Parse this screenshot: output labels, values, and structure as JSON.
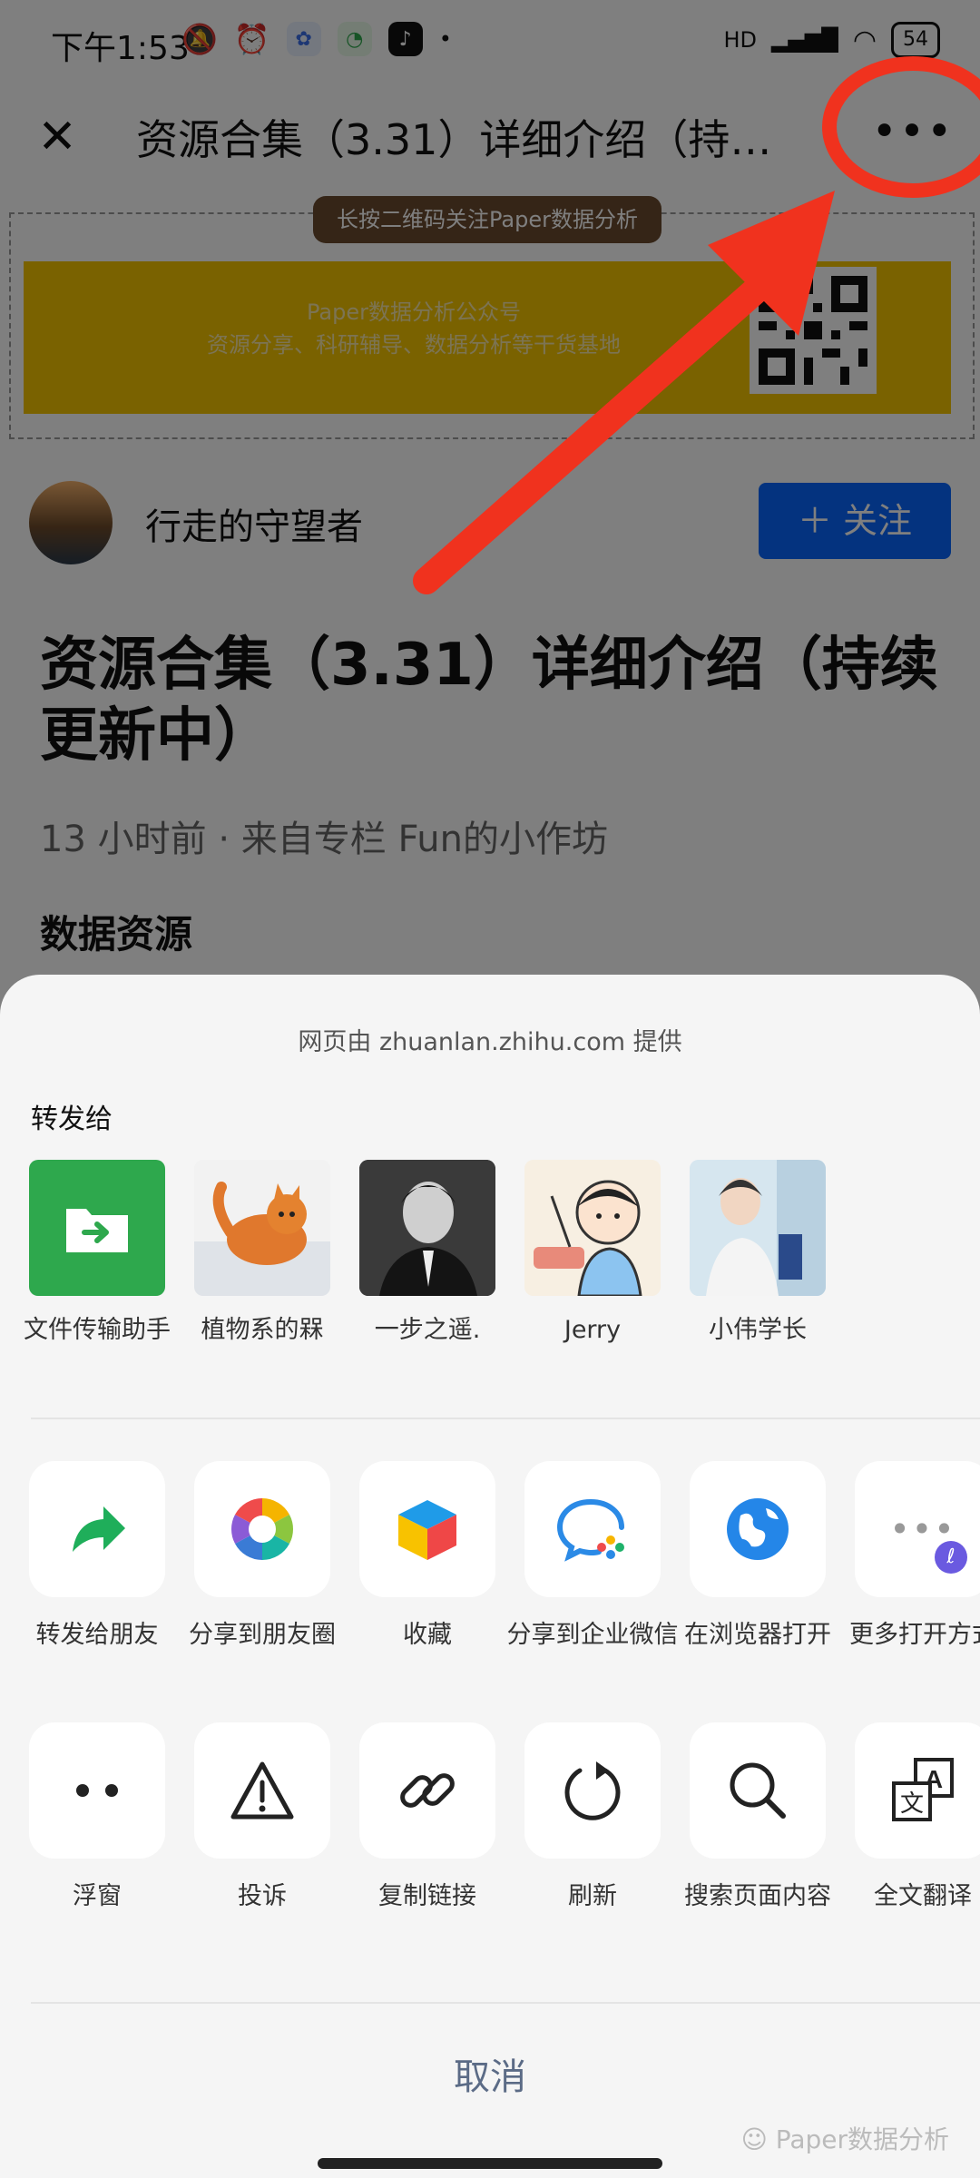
{
  "status_bar": {
    "time": "下午1:53",
    "signal": "HD",
    "battery": "54"
  },
  "navbar": {
    "title": "资源合集（3.31）详细介绍（持续…",
    "more_glyph": "•••",
    "close_glyph": "✕"
  },
  "banner": {
    "tag": "长按二维码关注Paper数据分析",
    "line1": "Paper数据分析公众号",
    "line2": "资源分享、科研辅导、数据分析等干货基地"
  },
  "author": {
    "name": "行走的守望者",
    "follow_label": "＋ 关注"
  },
  "article": {
    "title": "资源合集（3.31）详细介绍（持续更新中）",
    "meta": "13 小时前 · 来自专栏 Fun的小作坊",
    "section_heading": "数据资源"
  },
  "sheet": {
    "provider": "网页由 zhuanlan.zhihu.com 提供",
    "share_label": "转发给",
    "contacts": [
      {
        "name": "文件传输助手",
        "icon": "file-transfer-icon"
      },
      {
        "name": "植物系的槑",
        "icon": "cat-avatar"
      },
      {
        "name": "一步之遥.",
        "icon": "man-avatar"
      },
      {
        "name": "Jerry",
        "icon": "cartoon-avatar"
      },
      {
        "name": "小伟学长",
        "icon": "person-avatar"
      }
    ],
    "actions_row1": [
      {
        "label": "转发给朋友",
        "icon": "forward-icon"
      },
      {
        "label": "分享到朋友圈",
        "icon": "moments-icon"
      },
      {
        "label": "收藏",
        "icon": "favorite-cube-icon"
      },
      {
        "label": "分享到企业微信",
        "icon": "wecom-icon"
      },
      {
        "label": "在浏览器打开",
        "icon": "browser-icon"
      },
      {
        "label": "更多打开方式",
        "icon": "more-open-icon"
      }
    ],
    "actions_row2": [
      {
        "label": "浮窗",
        "icon": "float-window-icon"
      },
      {
        "label": "投诉",
        "icon": "warning-icon"
      },
      {
        "label": "复制链接",
        "icon": "link-icon"
      },
      {
        "label": "刷新",
        "icon": "refresh-icon"
      },
      {
        "label": "搜索页面内容",
        "icon": "search-icon"
      },
      {
        "label": "全文翻译",
        "icon": "translate-icon"
      }
    ],
    "cancel_label": "取消",
    "watermark": "Paper数据分析"
  },
  "colors": {
    "overlay": "#000000",
    "annotation_red": "#f0321e",
    "follow_blue": "#0866ff",
    "wechat_green": "#2ea84d"
  }
}
